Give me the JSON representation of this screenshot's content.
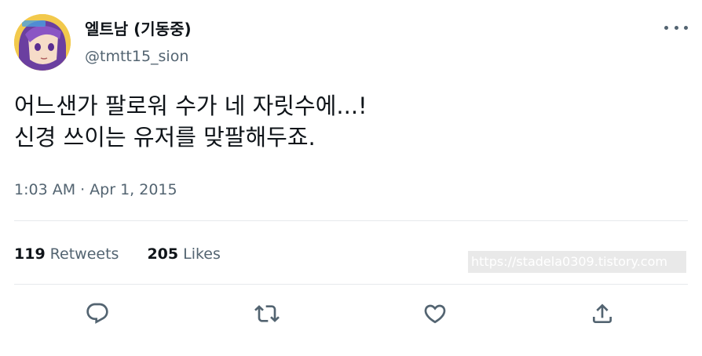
{
  "tweet": {
    "author": {
      "display_name": "엘트남 (기동중)",
      "handle": "@tmtt15_sion",
      "avatar_icon": "avatar-anime-character"
    },
    "text_lines": [
      "어느샌가 팔로워 수가 네 자릿수에...!",
      "신경 쓰이는 유저를 맞팔해두죠."
    ],
    "time": "1:03 AM",
    "separator": "·",
    "date": "Apr 1, 2015",
    "stats": {
      "retweets_count": "119",
      "retweets_label": "Retweets",
      "likes_count": "205",
      "likes_label": "Likes"
    },
    "actions": [
      "reply-icon",
      "retweet-icon",
      "like-icon",
      "share-icon"
    ]
  },
  "watermark": "https://stadela0309.tistory.com",
  "colors": {
    "text_primary": "#0f1419",
    "text_secondary": "#536471",
    "divider": "#e6e9ec",
    "icon": "#536471"
  }
}
